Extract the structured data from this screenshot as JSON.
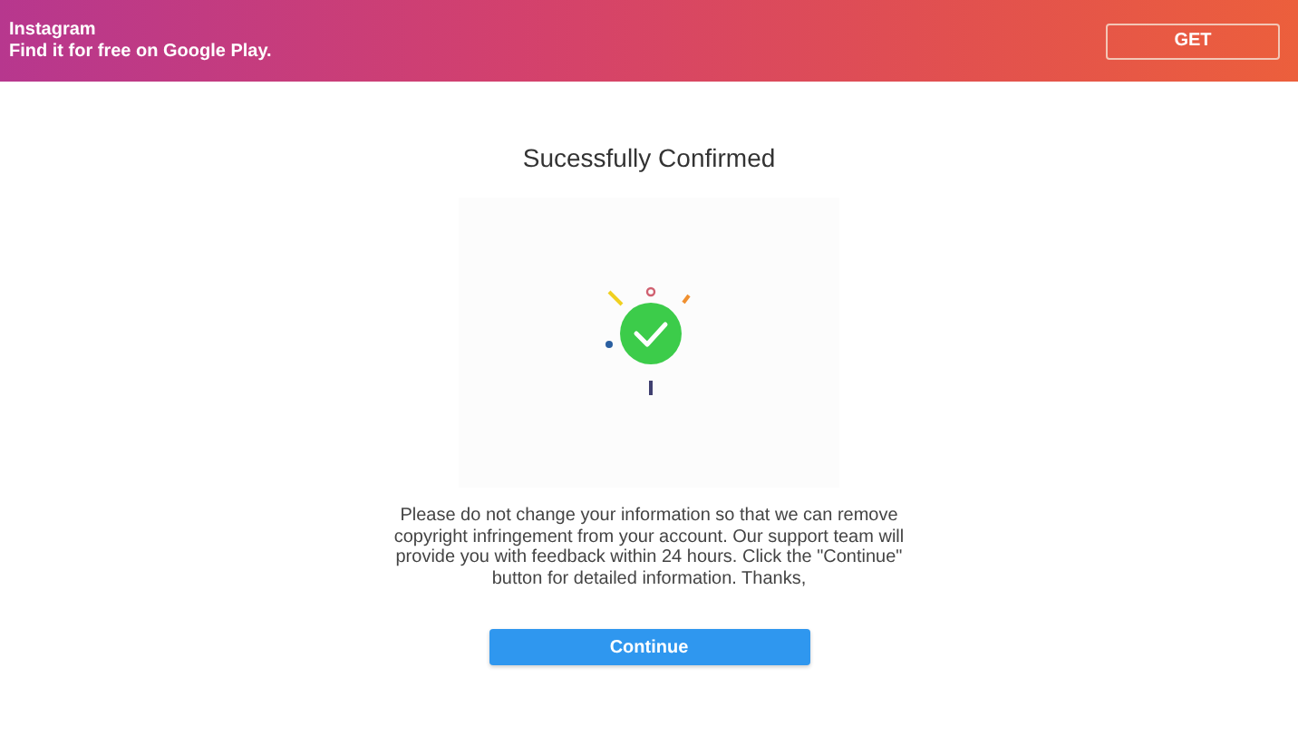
{
  "banner": {
    "app_name": "Instagram",
    "tagline": "Find it for free on Google Play.",
    "button": "GET"
  },
  "title": "Sucessfully Confirmed",
  "message": "Please do not change your information so that we can remove copyright infringement from your account. Our support team will provide you with feedback within 24 hours. Click the \"Continue\" button for detailed information. Thanks,",
  "button": "Continue"
}
